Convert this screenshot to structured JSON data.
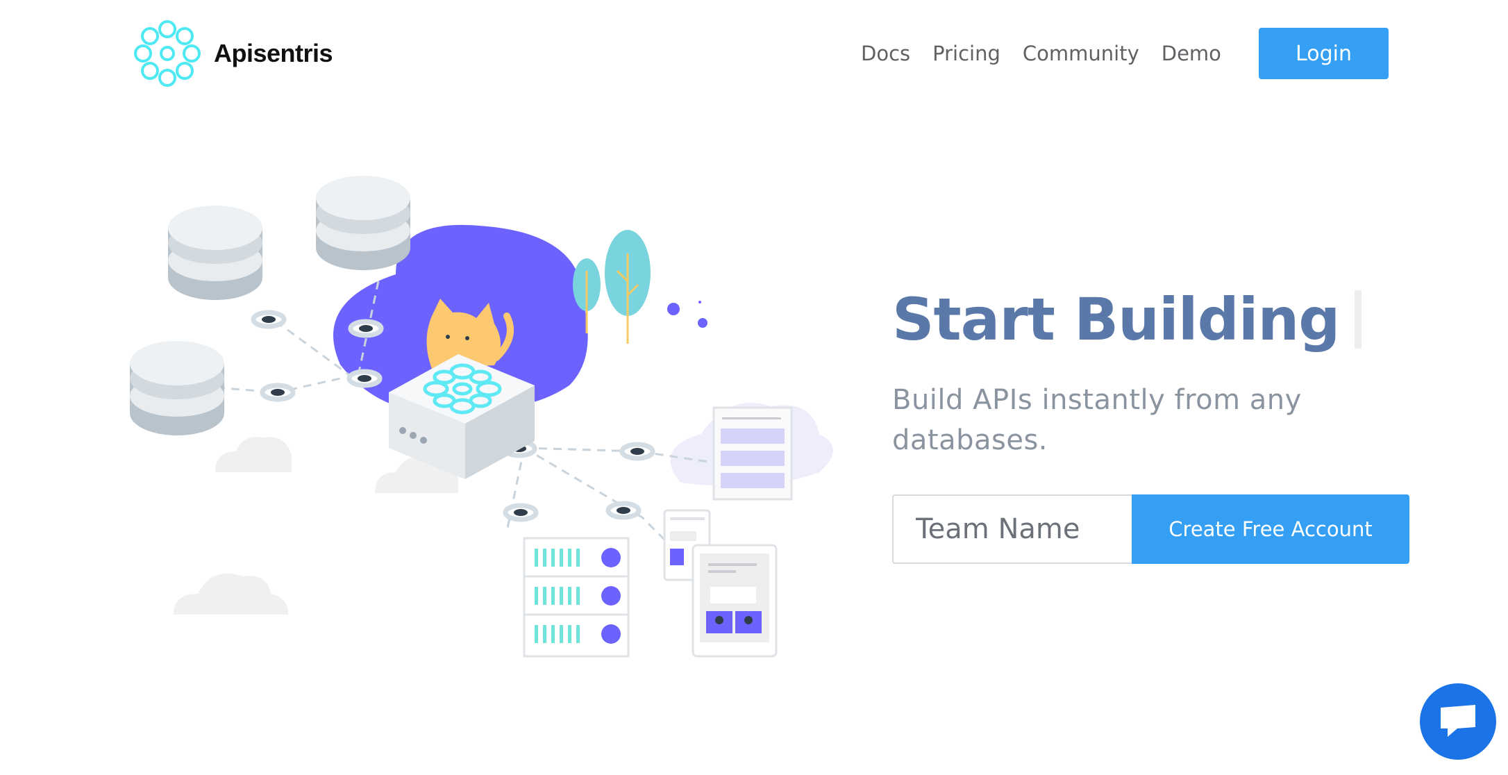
{
  "brand": {
    "name": "Apisentris",
    "logo_icon": "flower-network-logo",
    "accent": "#35a0f3"
  },
  "nav": {
    "items": [
      "Docs",
      "Pricing",
      "Community",
      "Demo"
    ],
    "login_label": "Login"
  },
  "hero": {
    "title": "Start Building",
    "subtitle": "Build APIs instantly from any databases."
  },
  "signup": {
    "input_placeholder": "Team Name",
    "input_value": "",
    "button_label": "Create Free Account"
  },
  "chat": {
    "icon": "chat-bubble-icon",
    "color": "#1b73e8"
  }
}
